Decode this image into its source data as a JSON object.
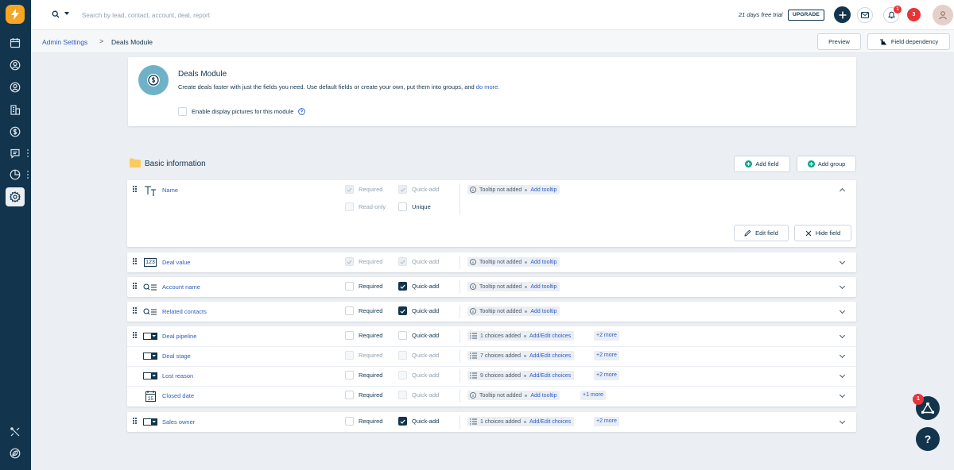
{
  "search": {
    "placeholder": "Search by lead, contact, account, deal, report"
  },
  "topbar": {
    "trial_text": "21 days free trial",
    "upgrade_label": "UPGRADE",
    "notification_count": "1",
    "alerts_count": "3"
  },
  "breadcrumb": {
    "parent": "Admin Settings",
    "separator": ">",
    "current": "Deals Module"
  },
  "header_buttons": {
    "preview": "Preview",
    "field_dependency": "Field dependency"
  },
  "module": {
    "title": "Deals Module",
    "description": "Create deals faster with just the fields you need. Use default fields or create your own, put them into groups, and ",
    "description_link": "do more.",
    "display_pictures_label": "Enable display pictures for this module"
  },
  "section": {
    "title": "Basic information",
    "add_field": "Add field",
    "add_group": "Add group"
  },
  "labels": {
    "required": "Required",
    "quick_add": "Quick-add",
    "read_only": "Read-only",
    "unique": "Unique",
    "tooltip_not_added": "Tooltip not added",
    "add_tooltip": "Add tooltip",
    "add_edit_choices": "Add/Edit choices",
    "edit_field": "Edit field",
    "hide_field": "Hide field"
  },
  "fields": [
    {
      "name": "Name",
      "icon": "text-field-icon",
      "required": "checked-disabled",
      "quick_add": "checked-disabled",
      "info": "Tooltip not added",
      "link": "Add tooltip",
      "expanded": true
    },
    {
      "name": "Deal value",
      "icon": "number-field-icon",
      "icon_text": "123",
      "required": "checked-disabled",
      "quick_add": "checked-disabled",
      "info": "Tooltip not added",
      "link": "Add tooltip"
    },
    {
      "name": "Account name",
      "icon": "lookup-field-icon",
      "required": "unchecked",
      "quick_add": "checked",
      "info": "Tooltip not added",
      "link": "Add tooltip"
    },
    {
      "name": "Related contacts",
      "icon": "lookup-field-icon",
      "required": "unchecked",
      "quick_add": "checked",
      "info": "Tooltip not added",
      "link": "Add tooltip"
    },
    {
      "name": "Deal pipeline",
      "icon": "dropdown-field-icon",
      "required": "unchecked",
      "quick_add": "unchecked",
      "info": "1 choices added",
      "link": "Add/Edit choices",
      "more": "+2 more"
    },
    {
      "name": "Deal stage",
      "icon": "dropdown-field-icon",
      "required": "disabled",
      "quick_add": "disabled",
      "info": "7 choices added",
      "link": "Add/Edit choices",
      "more": "+2 more"
    },
    {
      "name": "Lost reason",
      "icon": "dropdown-field-icon",
      "required": "unchecked",
      "quick_add": "disabled",
      "info": "9 choices added",
      "link": "Add/Edit choices",
      "more": "+2 more"
    },
    {
      "name": "Closed date",
      "icon": "date-field-icon",
      "icon_text": "25",
      "required": "unchecked",
      "quick_add": "disabled",
      "info": "Tooltip not added",
      "link": "Add tooltip",
      "more": "+1 more"
    },
    {
      "name": "Sales owner",
      "icon": "dropdown-field-icon",
      "required": "unchecked",
      "quick_add": "checked",
      "info": "1 choices added",
      "link": "Add/Edit choices",
      "more": "+2 more"
    }
  ],
  "fab": {
    "badge": "1",
    "help": "?"
  },
  "colors": {
    "nav_bg": "#12344d",
    "brand": "#f5a623",
    "link": "#2c5cc5",
    "danger": "#e43538",
    "success": "#00a886",
    "page_bg": "#ebeff3"
  }
}
